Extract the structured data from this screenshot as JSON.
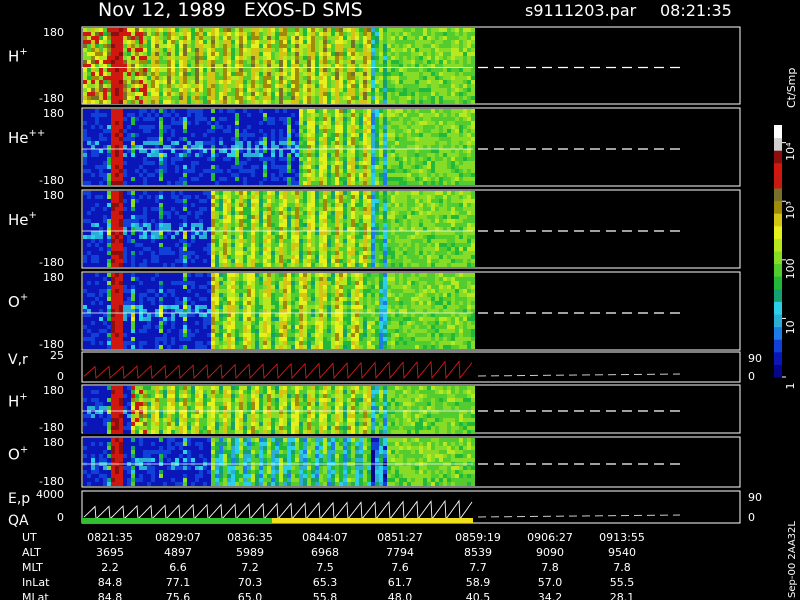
{
  "header": {
    "title": "Nov 12, 1989   EXOS-D SMS",
    "file": "s9111203.par",
    "time": "08:21:35"
  },
  "colorbar": {
    "unit": "Ct/Smp",
    "ticks": [
      {
        "label": "1",
        "value": 1
      },
      {
        "label": "10",
        "value": 10
      },
      {
        "label": "100",
        "value": 100
      },
      {
        "label": "10³",
        "value": 1000
      },
      {
        "label": "10⁴",
        "value": 10000
      }
    ],
    "colors": [
      "#06068a",
      "#0a16b8",
      "#1040d8",
      "#1e7ce6",
      "#2aaed6",
      "#2ad0e8",
      "#16a070",
      "#22b83a",
      "#52cc2e",
      "#86dc26",
      "#b8e820",
      "#e6f01c",
      "#d4c414",
      "#a08a0a",
      "#787028",
      "#c81a12",
      "#d2180e",
      "#8c0e0e",
      "#d0d0d0",
      "#ffffff"
    ]
  },
  "chart_data": [
    {
      "type": "heatmap",
      "name": "H+",
      "ylabel": "H+",
      "yticks": [
        "180",
        "-180"
      ],
      "ylim": [
        -180,
        180
      ]
    },
    {
      "type": "heatmap",
      "name": "He++",
      "ylabel": "He++",
      "yticks": [
        "180",
        "-180"
      ],
      "ylim": [
        -180,
        180
      ]
    },
    {
      "type": "heatmap",
      "name": "He+",
      "ylabel": "He+",
      "yticks": [
        "180",
        "-180"
      ],
      "ylim": [
        -180,
        180
      ]
    },
    {
      "type": "heatmap",
      "name": "O+",
      "ylabel": "O+",
      "yticks": [
        "180",
        "-180"
      ],
      "ylim": [
        -180,
        180
      ]
    },
    {
      "type": "line",
      "name": "V,r",
      "ylabel": "V,r",
      "yticks": [
        "25",
        "0"
      ],
      "ylim": [
        0,
        25
      ],
      "right_ticks": [
        "90",
        "0"
      ]
    },
    {
      "type": "heatmap",
      "name": "H+ (2)",
      "ylabel": "H+",
      "yticks": [
        "180",
        "-180"
      ],
      "ylim": [
        -180,
        180
      ]
    },
    {
      "type": "heatmap",
      "name": "O+ (2)",
      "ylabel": "O+",
      "yticks": [
        "180",
        "-180"
      ],
      "ylim": [
        -180,
        180
      ]
    },
    {
      "type": "line",
      "name": "E,p",
      "ylabel": "E,p",
      "yticks": [
        "4000",
        "0"
      ],
      "ylim": [
        0,
        4000
      ],
      "right_ticks": [
        "90",
        "0"
      ]
    }
  ],
  "qa_label": "QA",
  "ephemeris": {
    "rows": [
      {
        "label": "UT",
        "values": [
          "0821:35",
          "0829:07",
          "0836:35",
          "0844:07",
          "0851:27",
          "0859:19",
          "0906:27",
          "0913:55"
        ]
      },
      {
        "label": "ALT",
        "values": [
          "3695",
          "4897",
          "5989",
          "6968",
          "7794",
          "8539",
          "9090",
          "9540"
        ]
      },
      {
        "label": "MLT",
        "values": [
          "2.2",
          "6.6",
          "7.2",
          "7.5",
          "7.6",
          "7.7",
          "7.8",
          "7.8"
        ]
      },
      {
        "label": "InLat",
        "values": [
          "84.8",
          "77.1",
          "70.3",
          "65.3",
          "61.7",
          "58.9",
          "57.0",
          "55.5"
        ]
      },
      {
        "label": "MLat",
        "values": [
          "84.8",
          "75.6",
          "65.0",
          "55.8",
          "48.0",
          "40.5",
          "34.2",
          "28.1"
        ]
      }
    ]
  },
  "footer_stamp": "Sep-00  2AA32L"
}
